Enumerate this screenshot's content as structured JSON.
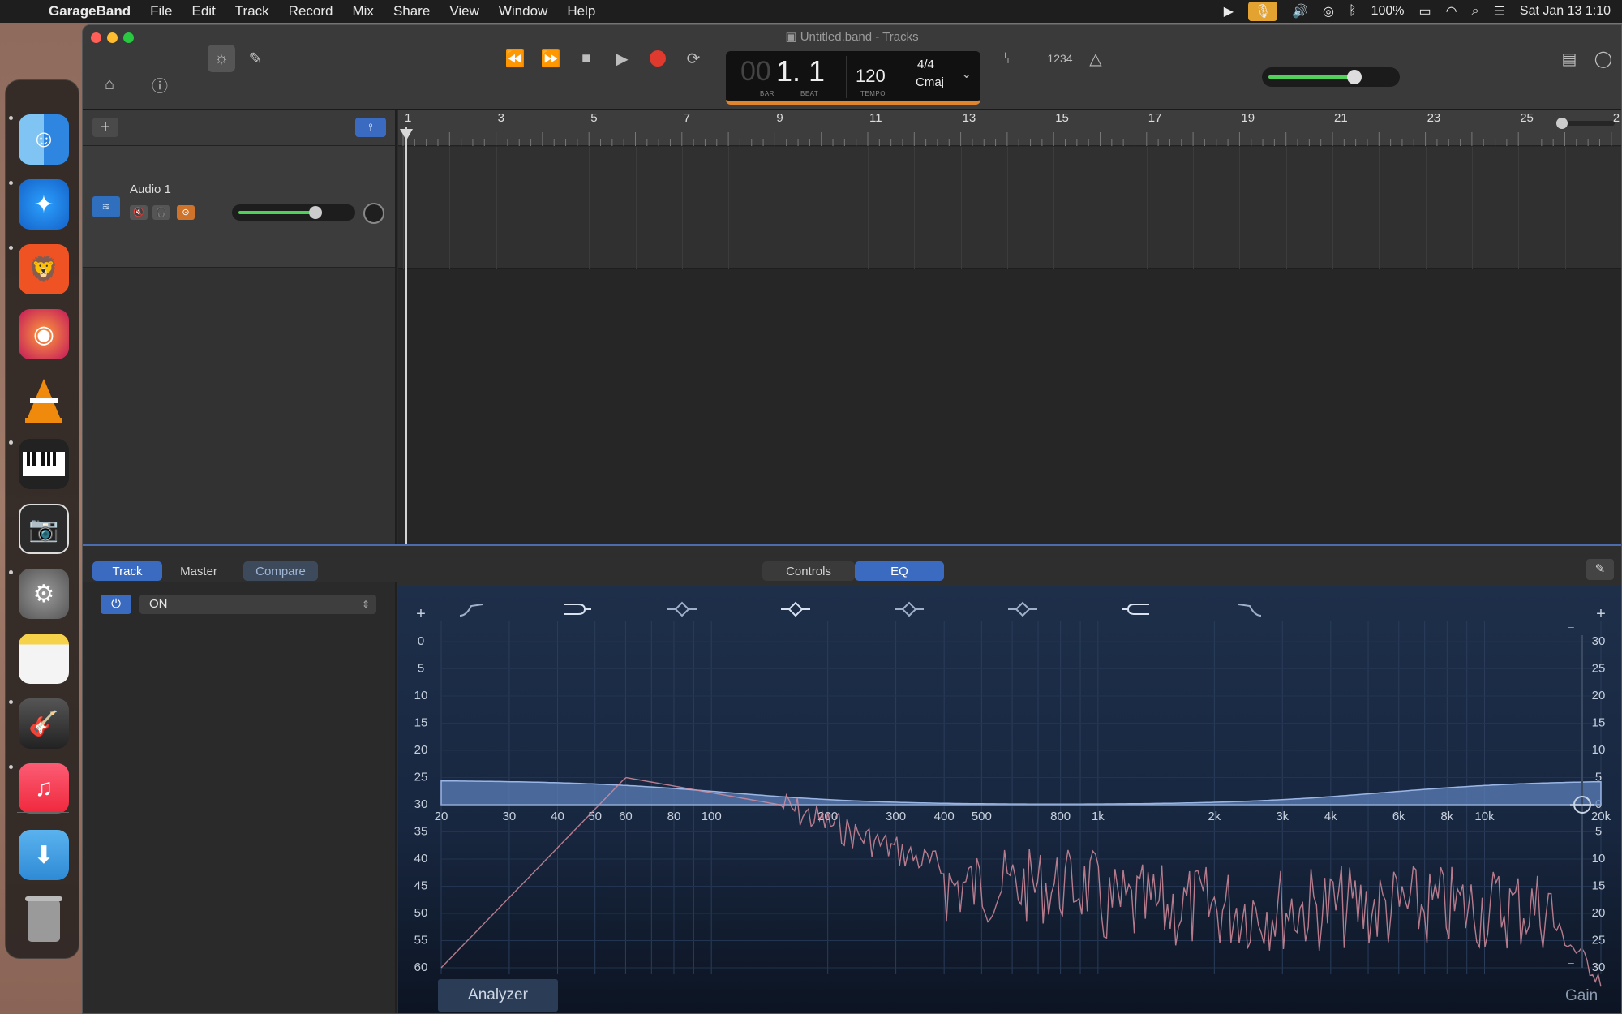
{
  "menubar": {
    "app_name": "GarageBand",
    "items": [
      "File",
      "Edit",
      "Track",
      "Record",
      "Mix",
      "Share",
      "View",
      "Window",
      "Help"
    ],
    "battery": "100%",
    "datetime": "Sat Jan 13  1:10"
  },
  "window": {
    "title": "Untitled.band - Tracks"
  },
  "lcd": {
    "bar_dim": "00",
    "position": "1. 1",
    "bar_label": "BAR",
    "beat_label": "BEAT",
    "tempo": "120",
    "tempo_label": "TEMPO",
    "time_signature": "4/4",
    "key": "Cmaj"
  },
  "toolbar": {
    "count_in": "1234"
  },
  "ruler": {
    "bars": [
      "1",
      "3",
      "5",
      "7",
      "9",
      "11",
      "13",
      "15",
      "17",
      "19",
      "21",
      "23",
      "25",
      "2"
    ]
  },
  "track": {
    "name": "Audio 1",
    "volume": 0.7
  },
  "master_volume": 0.7,
  "editor": {
    "tabs": [
      "Track",
      "Master"
    ],
    "compare": "Compare",
    "view_tabs": [
      "Controls",
      "EQ"
    ],
    "active_view": "EQ",
    "power_state": "ON"
  },
  "eq": {
    "left_axis": [
      "0",
      "5",
      "10",
      "15",
      "20",
      "25",
      "30",
      "35",
      "40",
      "45",
      "50",
      "55",
      "60"
    ],
    "right_axis": [
      "30",
      "25",
      "20",
      "15",
      "10",
      "5",
      "0",
      "5",
      "10",
      "15",
      "20",
      "25",
      "30"
    ],
    "freq_labels": [
      "20",
      "30",
      "40",
      "50",
      "60",
      "80",
      "100",
      "200",
      "300",
      "400",
      "500",
      "800",
      "1k",
      "2k",
      "3k",
      "4k",
      "6k",
      "8k",
      "10k",
      "20k"
    ],
    "analyzer_label": "Analyzer",
    "gain_label": "Gain",
    "plus": "+",
    "minus": "–"
  },
  "colors": {
    "accent": "#3b6bc0",
    "record": "#e03a2f",
    "lcd_bar": "#e0842f",
    "eq_curve": "#7f9fd6",
    "analyzer_line": "#d28c9c"
  }
}
